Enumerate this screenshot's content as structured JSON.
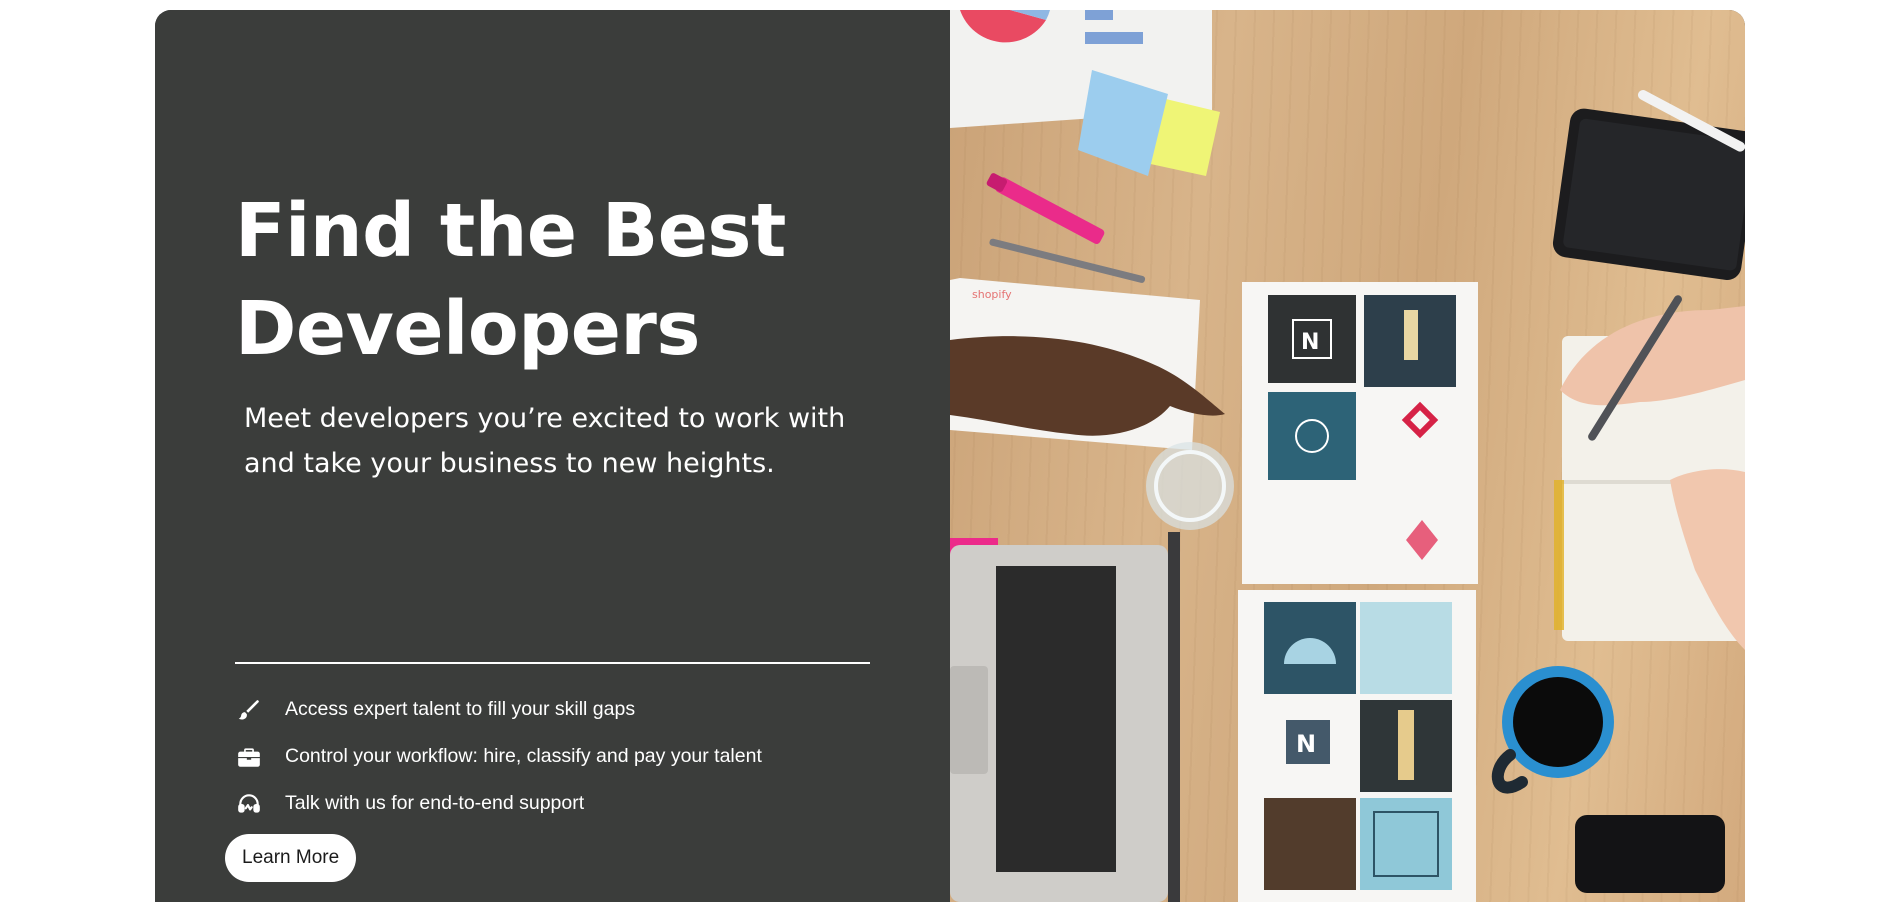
{
  "hero": {
    "title_line1": "Find the Best",
    "title_line2": "Developers",
    "subtitle_line1": "Meet developers you’re excited to work with",
    "subtitle_line2": "and take your business to new heights.",
    "features": [
      {
        "icon": "paintbrush-icon",
        "text": "Access expert talent to fill your skill gaps"
      },
      {
        "icon": "briefcase-icon",
        "text": "Control your workflow: hire, classify and pay your talent"
      },
      {
        "icon": "headset-icon",
        "text": "Talk with us for end-to-end support"
      }
    ],
    "cta_label": "Learn More"
  },
  "photo": {
    "logo_card_letter": "N",
    "logo_card_letter_2": "N",
    "envelope_brand": "shopify"
  },
  "colors": {
    "panel_bg": "#3b3d3b",
    "text": "#ffffff",
    "button_bg": "#ffffff",
    "button_text": "#1b1b1b"
  }
}
